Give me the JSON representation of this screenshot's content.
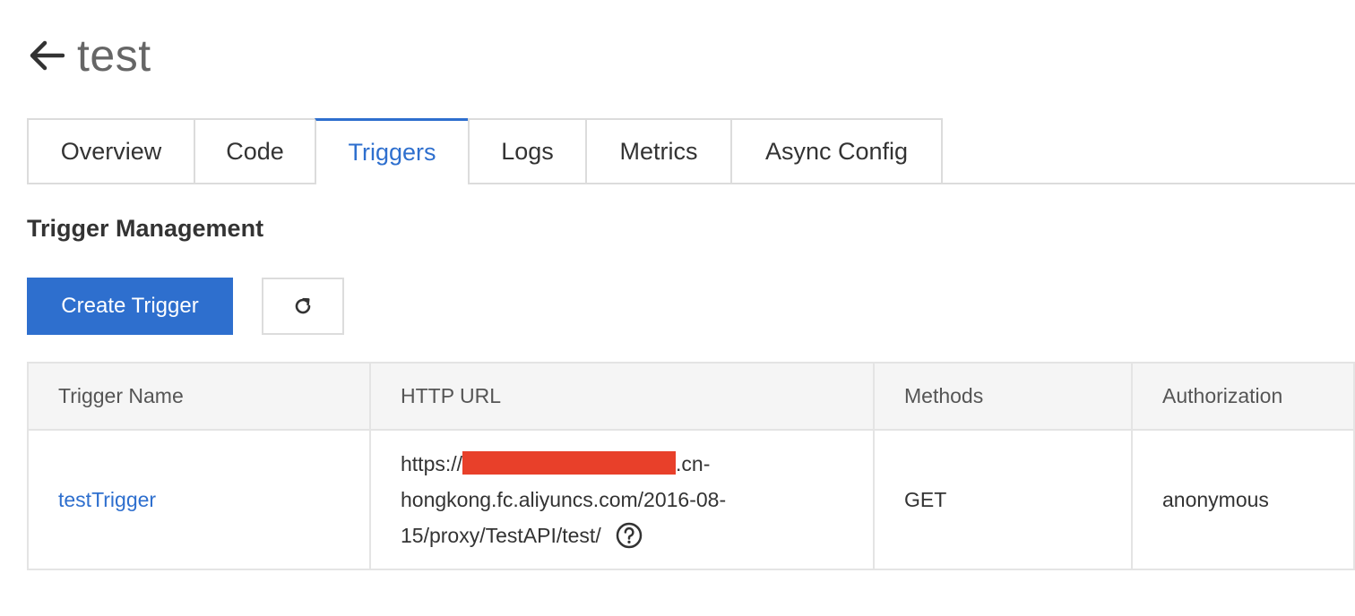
{
  "header": {
    "back_icon": "arrow-left-icon",
    "title": "test"
  },
  "tabs": [
    {
      "label": "Overview",
      "active": false
    },
    {
      "label": "Code",
      "active": false
    },
    {
      "label": "Triggers",
      "active": true
    },
    {
      "label": "Logs",
      "active": false
    },
    {
      "label": "Metrics",
      "active": false
    },
    {
      "label": "Async Config",
      "active": false
    }
  ],
  "section": {
    "title": "Trigger Management"
  },
  "toolbar": {
    "create_label": "Create Trigger",
    "refresh_icon": "refresh-icon"
  },
  "table": {
    "columns": [
      "Trigger Name",
      "HTTP URL",
      "Methods",
      "Authorization"
    ],
    "rows": [
      {
        "name": "testTrigger",
        "url_prefix": "https://",
        "url_suffix_line1": ".cn-",
        "url_line2": "hongkong.fc.aliyuncs.com/2016-08-",
        "url_line3": "15/proxy/TestAPI/test/",
        "methods": "GET",
        "authorization": "anonymous"
      }
    ]
  },
  "colors": {
    "accent": "#2e6fce",
    "redaction": "#e8402a",
    "border": "#dcdcdc"
  }
}
